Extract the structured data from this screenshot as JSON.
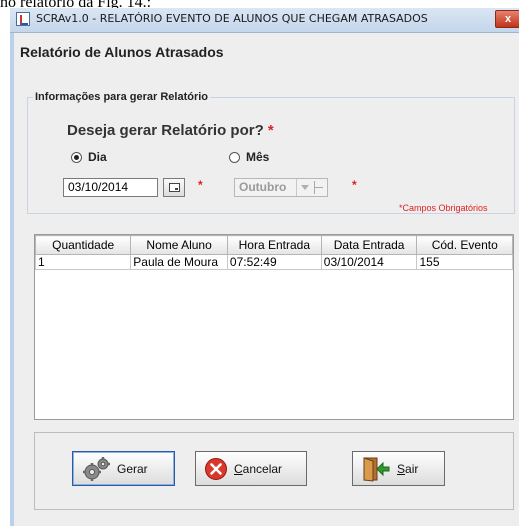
{
  "caption": "no relatório da Fig. 14.:",
  "window": {
    "title": "SCRAv1.0 - RELATÓRIO EVENTO DE ALUNOS QUE CHEGAM ATRASADOS",
    "close_label": "x",
    "heading": "Relatório de Alunos Atrasados"
  },
  "form": {
    "group_label": "Informações para gerar Relatório",
    "question": "Deseja gerar Relatório por?",
    "required_mark": "*",
    "option_day": "Dia",
    "option_month": "Mês",
    "selected_option": "Dia",
    "date_value": "03/10/2014",
    "month_value": "Outubro",
    "required_note": "*Campos Obrigatórios"
  },
  "table": {
    "columns": [
      "Quantidade",
      "Nome Aluno",
      "Hora Entrada",
      "Data Entrada",
      "Cód. Evento"
    ],
    "rows": [
      [
        "1",
        "Paula de Moura",
        "07:52:49",
        "03/10/2014",
        "155"
      ]
    ]
  },
  "buttons": {
    "gerar": "Gerar",
    "cancelar_first": "C",
    "cancelar_rest": "ancelar",
    "sair_first": "S",
    "sair_rest": "air"
  },
  "icons": {
    "gerar": "gears-icon",
    "cancelar": "red-x-circle-icon",
    "sair": "exit-door-icon",
    "calendar": "calendar-icon"
  },
  "colors": {
    "required": "#e02020",
    "window_bg": "#eeeeee"
  }
}
